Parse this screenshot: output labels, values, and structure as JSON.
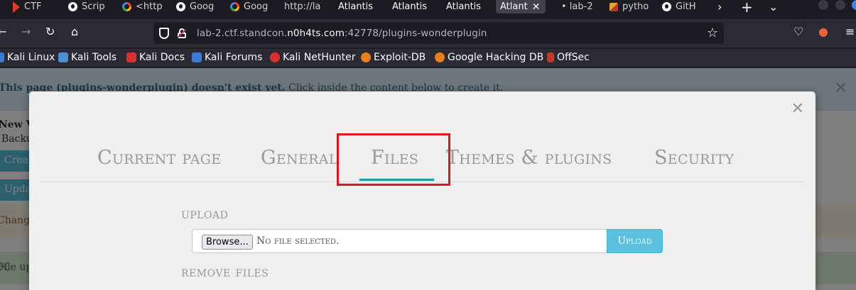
{
  "browser": {
    "tabs": [
      {
        "label": "CTF",
        "icon": "ctf-flag-icon"
      },
      {
        "label": "Scrip",
        "icon": "github-icon"
      },
      {
        "label": "<http",
        "icon": "google-icon"
      },
      {
        "label": "Goog",
        "icon": "github-icon"
      },
      {
        "label": "Goog",
        "icon": "google-icon"
      },
      {
        "label": "http://la",
        "icon": ""
      },
      {
        "label": "Atlantis",
        "icon": ""
      },
      {
        "label": "Atlantis",
        "icon": ""
      },
      {
        "label": "Atlantis",
        "icon": ""
      },
      {
        "label": "Atlant",
        "icon": "",
        "active": true
      },
      {
        "label": "• lab-2",
        "icon": ""
      },
      {
        "label": "pytho",
        "icon": "python-icon"
      },
      {
        "label": "GitH",
        "icon": "github-icon"
      }
    ],
    "url": {
      "prefix": "lab-2.ctf.standcon.",
      "host": "n0h4ts.com",
      "suffix": ":42778/plugins-wonderplugin"
    },
    "bookmarks": [
      {
        "label": "Kali Linux",
        "color": "#3a7bd5"
      },
      {
        "label": "Kali Tools",
        "color": "#4a90d9"
      },
      {
        "label": "Kali Docs",
        "color": "#d63031"
      },
      {
        "label": "Kali Forums",
        "color": "#3a7bd5"
      },
      {
        "label": "Kali NetHunter",
        "color": "#d63031"
      },
      {
        "label": "Exploit-DB",
        "color": "#e67e22"
      },
      {
        "label": "Google Hacking DB",
        "color": "#e67e22"
      },
      {
        "label": "OffSec",
        "color": "#c0392b"
      }
    ]
  },
  "page": {
    "notice_bold": "This page (plugins-wonderplugin) doesn't exist yet.",
    "notice_rest": " Click inside the content below to create it.",
    "behind_title": "New V",
    "behind_sub": "Backu",
    "behind_btn1": "Crea",
    "behind_btn2": "Upda",
    "alert_warn": "Chang",
    "alert_ok": "File up"
  },
  "modal": {
    "tabs": [
      "Current page",
      "General",
      "Files",
      "Themes & plugins",
      "Security"
    ],
    "active_tab": "Files",
    "upload_title": "upload",
    "browse_label": "Browse...",
    "file_status": "No file selected.",
    "upload_button": "Upload",
    "remove_title": "remove files"
  },
  "colors": {
    "accent": "#1b9da8",
    "info_button": "#5bc0de",
    "highlight_box": "#e0141e"
  }
}
